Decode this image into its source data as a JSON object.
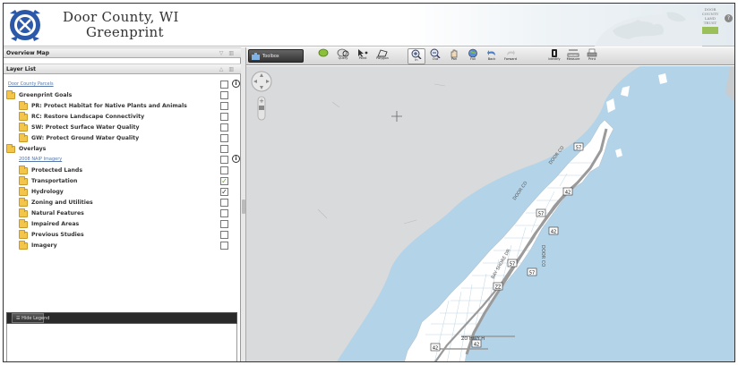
{
  "header": {
    "title_line1": "Door County, WI",
    "title_line2": "Greenprint"
  },
  "panels": {
    "overview_map": "Overview Map",
    "layer_list": "Layer List"
  },
  "layers": [
    {
      "label": "Door County Parcels",
      "type": "link",
      "indent": 0,
      "checked": false,
      "info": true
    },
    {
      "label": "Greenprint Goals",
      "type": "group",
      "indent": 0,
      "checked": false,
      "info": false
    },
    {
      "label": "PR: Protect Habitat for Native Plants and Animals",
      "type": "folder",
      "indent": 1,
      "checked": false,
      "info": false
    },
    {
      "label": "RC: Restore Landscape Connectivity",
      "type": "folder",
      "indent": 1,
      "checked": false,
      "info": false
    },
    {
      "label": "SW: Protect Surface Water Quality",
      "type": "folder",
      "indent": 1,
      "checked": false,
      "info": false
    },
    {
      "label": "GW: Protect Ground Water Quality",
      "type": "folder",
      "indent": 1,
      "checked": false,
      "info": false
    },
    {
      "label": "Overlays",
      "type": "group",
      "indent": 0,
      "checked": false,
      "info": false
    },
    {
      "label": "2008 NAIP Imagery",
      "type": "link",
      "indent": 1,
      "checked": false,
      "info": true
    },
    {
      "label": "Protected Lands",
      "type": "folder",
      "indent": 1,
      "checked": false,
      "info": false
    },
    {
      "label": "Transportation",
      "type": "folder",
      "indent": 1,
      "checked": true,
      "mark": "green",
      "info": false
    },
    {
      "label": "Hydrology",
      "type": "folder",
      "indent": 1,
      "checked": true,
      "mark": "dark",
      "info": false
    },
    {
      "label": "Zoning and Utilities",
      "type": "folder",
      "indent": 1,
      "checked": false,
      "info": false
    },
    {
      "label": "Natural Features",
      "type": "folder",
      "indent": 1,
      "checked": false,
      "info": false
    },
    {
      "label": "Impaired Areas",
      "type": "folder",
      "indent": 1,
      "checked": false,
      "info": false
    },
    {
      "label": "Previous Studies",
      "type": "folder",
      "indent": 1,
      "checked": false,
      "info": false
    },
    {
      "label": "Imagery",
      "type": "folder",
      "indent": 1,
      "checked": false,
      "info": false
    }
  ],
  "legend": {
    "hide_label": "Hide Legend"
  },
  "toolbar": {
    "toolbox_label": "Toolbox",
    "tools": [
      {
        "id": "layers",
        "label": "",
        "icon": "layers-icon"
      },
      {
        "id": "query",
        "label": "Query",
        "icon": "query-icon"
      },
      {
        "id": "point",
        "label": "Point",
        "icon": "point-icon"
      },
      {
        "id": "polygon",
        "label": "Polygon",
        "icon": "polygon-icon"
      },
      {
        "id": "zoom-in",
        "label": "In",
        "icon": "zoom-in-icon",
        "active": true
      },
      {
        "id": "zoom-out",
        "label": "Out",
        "icon": "zoom-out-icon"
      },
      {
        "id": "pan",
        "label": "Pan",
        "icon": "pan-icon"
      },
      {
        "id": "full",
        "label": "Full",
        "icon": "full-extent-icon"
      },
      {
        "id": "back",
        "label": "Back",
        "icon": "back-icon"
      },
      {
        "id": "forward",
        "label": "Forward",
        "icon": "forward-icon"
      },
      {
        "id": "identify",
        "label": "Identify",
        "icon": "identify-icon"
      },
      {
        "id": "measure",
        "label": "Measure",
        "icon": "measure-icon"
      },
      {
        "id": "print",
        "label": "Print",
        "icon": "print-icon"
      }
    ]
  },
  "map": {
    "road_labels": [
      "57",
      "42",
      "57",
      "42",
      "57",
      "ZZ",
      "57",
      "42",
      "42"
    ],
    "road_names": [
      "DOOR CO",
      "BAY SHORE DR",
      "DOOR CO",
      "ZO HWY H",
      "DOOR CO"
    ]
  },
  "colors": {
    "water": "#b3d3e8",
    "land": "#d8dadb",
    "peninsula": "#ffffff",
    "road": "#9a9a9a",
    "folder": "#f3c54a"
  }
}
